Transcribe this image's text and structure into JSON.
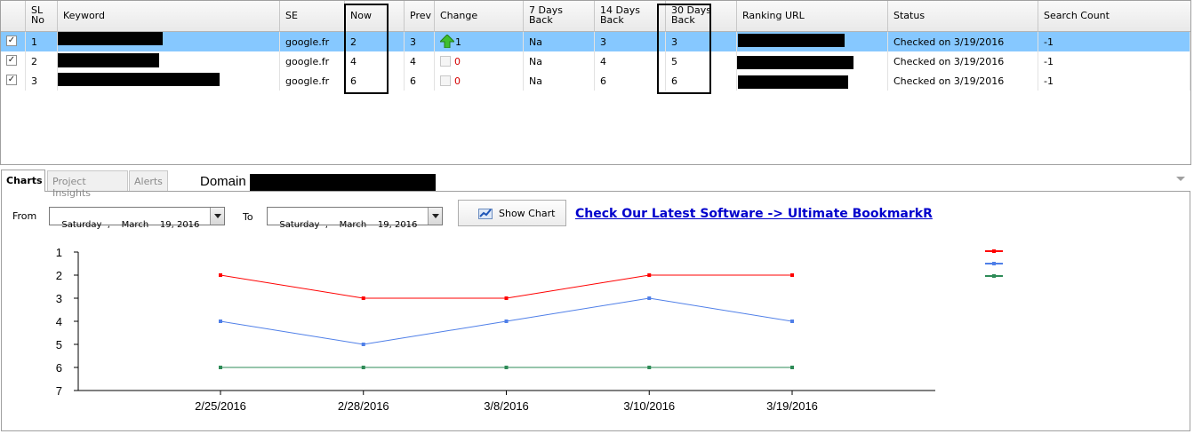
{
  "grid": {
    "headers": {
      "sl_no": "SL No",
      "keyword": "Keyword",
      "se": "SE",
      "now": "Now",
      "prev": "Prev",
      "change": "Change",
      "days7": "7 Days Back",
      "days14": "14 Days Back",
      "days30": "30 Days Back",
      "ranking_url": "Ranking URL",
      "status": "Status",
      "search_count": "Search Count"
    },
    "rows": [
      {
        "checked": true,
        "sl": "1",
        "se": "google.fr",
        "now": "2",
        "prev": "3",
        "change": "1",
        "change_dir": "up",
        "d7": "Na",
        "d14": "3",
        "d30": "3",
        "status": "Checked on 3/19/2016",
        "search_count": "-1"
      },
      {
        "checked": true,
        "sl": "2",
        "se": "google.fr",
        "now": "4",
        "prev": "4",
        "change": "0",
        "change_dir": "none",
        "d7": "Na",
        "d14": "4",
        "d30": "5",
        "status": "Checked on 3/19/2016",
        "search_count": "-1"
      },
      {
        "checked": true,
        "sl": "3",
        "se": "google.fr",
        "now": "6",
        "prev": "6",
        "change": "0",
        "change_dir": "none",
        "d7": "Na",
        "d14": "6",
        "d30": "6",
        "status": "Checked on 3/19/2016",
        "search_count": "-1"
      }
    ],
    "check_glyph": "✓"
  },
  "tabs": [
    {
      "label": "Charts",
      "active": true
    },
    {
      "label": "Project Insights",
      "active": false
    },
    {
      "label": "Alerts",
      "active": false
    }
  ],
  "domain_label": "Domain",
  "controls": {
    "from_label": "From",
    "to_label": "To",
    "from_date": "Saturday  ,    March    19, 2016",
    "to_date": "Saturday  ,    March    19, 2016",
    "show_chart_label": "Show Chart",
    "promo_link": "Check Our Latest Software -> Ultimate BookmarkR"
  },
  "colors": {
    "selected_row": "#86c8ff",
    "series_red": "#ff0000",
    "series_blue": "#4f7fe8",
    "series_green": "#2e8b57",
    "link": "#0000cc"
  },
  "chart_data": {
    "type": "line",
    "categories": [
      "2/25/2016",
      "2/28/2016",
      "3/8/2016",
      "3/10/2016",
      "3/19/2016"
    ],
    "ylim": [
      1,
      7
    ],
    "y_inverted": true,
    "yticks": [
      1,
      2,
      3,
      4,
      5,
      6,
      7
    ],
    "legend_position": "top-right",
    "series": [
      {
        "color": "#ff0000",
        "values": [
          2,
          3,
          3,
          2,
          2
        ]
      },
      {
        "color": "#4f7fe8",
        "values": [
          4,
          5,
          4,
          3,
          4
        ]
      },
      {
        "color": "#2e8b57",
        "values": [
          6,
          6,
          6,
          6,
          6
        ]
      }
    ]
  }
}
